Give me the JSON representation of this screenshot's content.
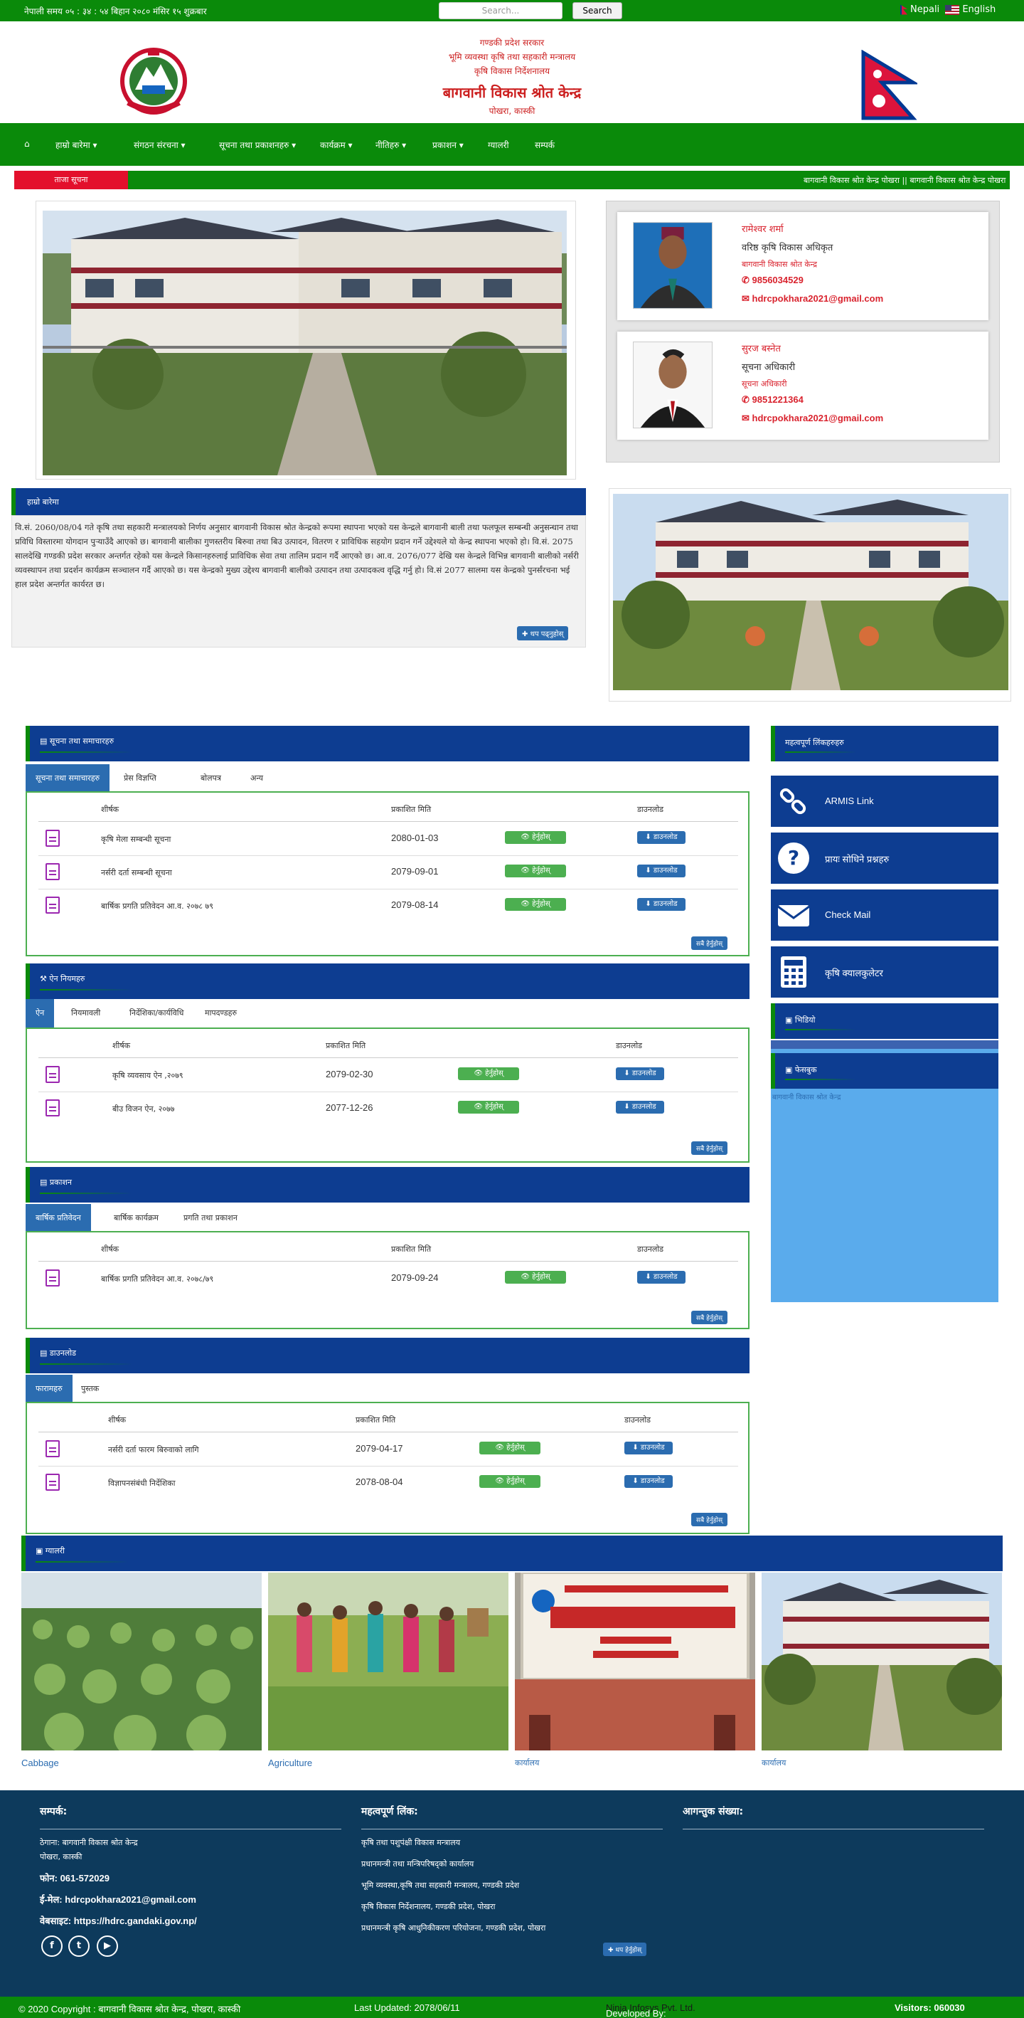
{
  "topbar": {
    "time": "नेपाली समय ०५ : ३४ : ५४ बिहान   २०८० मंसिर १५ शुक्रबार",
    "search_placeholder": "Search...",
    "search_button": "Search",
    "lang_nepali": "Nepali",
    "lang_english": "English"
  },
  "header": {
    "line1": "गण्डकी प्रदेश सरकार",
    "line2": "भूमि व्यवस्था कृषि तथा सहकारी मन्त्रालय",
    "line3": "कृषि विकास निर्देशनालय",
    "title": "बागवानी विकास श्रोत केन्द्र",
    "location": "पोखरा, कास्की"
  },
  "nav": {
    "home_icon": "home-icon",
    "items": [
      "हाम्रो बारेमा",
      "संगठन संरचना",
      "सूचना तथा प्रकाशनहरु",
      "कार्यक्रम",
      "नीतिहरु",
      "प्रकाशन",
      "ग्यालरी",
      "सम्पर्क"
    ]
  },
  "ticker": {
    "label": "ताजा सूचना",
    "text": "बागवानी विकास श्रोत केन्द्र पोखरा  || बागवानी विकास श्रोत केन्द्र पोखरा"
  },
  "officials": [
    {
      "name": "रामेश्वर शर्मा",
      "position": "वरिष्ठ कृषि विकास अधिकृत",
      "org": "बागवानी विकास श्रोत केन्द्र",
      "phone": "9856034529",
      "email": "hdrcpokhara2021@gmail.com"
    },
    {
      "name": "सुरज बस्नेत",
      "position": "सूचना अधिकारी",
      "org": "सूचना अधिकारी",
      "phone": "9851221364",
      "email": "hdrcpokhara2021@gmail.com"
    }
  ],
  "intro": {
    "heading": "हाम्रो बारेमा",
    "text": "वि.सं. 2060/08/04 गते कृषि तथा सहकारी मन्त्रालयको निर्णय अनुसार बागवानी विकास श्रोत केन्द्रको रूपमा स्थापना भएको यस केन्द्रले बागवानी बाली तथा फलफूल सम्बन्धी अनुसन्धान तथा प्रविधि विस्तारमा योगदान पुर्‍याउँदै आएको छ। बागवानी बालीका गुणस्तरीय बिरुवा तथा बिउ उत्पादन, वितरण र प्राविधिक सहयोग प्रदान गर्ने उद्देश्यले यो केन्द्र स्थापना भएको हो। वि.सं. 2075 सालदेखि गण्डकी प्रदेश सरकार अन्तर्गत रहेको यस केन्द्रले किसानहरुलाई प्राविधिक सेवा तथा तालिम प्रदान गर्दै आएको छ। आ.व. 2076/077 देखि यस केन्द्रले विभिन्न बागवानी बालीको नर्सरी व्यवस्थापन तथा प्रदर्शन कार्यक्रम सञ्चालन गर्दै आएको छ। यस केन्द्रको मुख्य उद्देश्य बागवानी बालीको उत्पादन तथा उत्पादकत्व वृद्धि गर्नु हो। वि.सं 2077 सालमा यस केन्द्रको पुनर्संरचना भई हाल प्रदेश अन्तर्गत कार्यरत छ।",
    "more": "थप पढ्नुहोस्"
  },
  "news": {
    "heading": "सूचना तथा समाचारहरु",
    "tabs": [
      "सूचना तथा समाचारहरु",
      "प्रेस विज्ञप्ति",
      "बोलपत्र",
      "अन्य"
    ],
    "headers": [
      "शीर्षक",
      "प्रकाशित मिति",
      "डाउनलोड"
    ],
    "rows": [
      {
        "title": "कृषि मेला सम्बन्धी सूचना",
        "date": "2080-01-03"
      },
      {
        "title": "नर्सरी दर्ता सम्बन्धी सूचना",
        "date": "2079-09-01"
      },
      {
        "title": "बार्षिक प्रगति प्रतिवेदन आ.व. २०७८ ७९",
        "date": "2079-08-14"
      }
    ],
    "view": "हेर्नुहोस्",
    "download": "डाउनलोड",
    "all": "सबै हेर्नुहोस्"
  },
  "laws": {
    "heading": "ऐन नियमहरु",
    "tabs": [
      "ऐन",
      "नियमावली",
      "निर्देशिका/कार्यविधि",
      "मापदण्डहरु"
    ],
    "headers": [
      "शीर्षक",
      "प्रकाशित मिति",
      "डाउनलोड"
    ],
    "rows": [
      {
        "title": "कृषि व्यवसाय ऐन ,२०७९",
        "date": "2079-02-30"
      },
      {
        "title": "बीउ विजन ऐन, २०७७",
        "date": "2077-12-26"
      }
    ],
    "view": "हेर्नुहोस्",
    "download": "डाउनलोड",
    "all": "सबै हेर्नुहोस्"
  },
  "reports": {
    "heading": "प्रकाशन",
    "tabs": [
      "बार्षिक प्रतिवेदन",
      "बार्षिक कार्यक्रम",
      "प्रगति तथा प्रकाशन"
    ],
    "headers": [
      "शीर्षक",
      "प्रकाशित मिति",
      "डाउनलोड"
    ],
    "rows": [
      {
        "title": "बार्षिक प्रगति प्रतिवेदन आ.व. २०७८/७९",
        "date": "2079-09-24"
      }
    ],
    "view": "हेर्नुहोस्",
    "download": "डाउनलोड",
    "all": "सबै हेर्नुहोस्"
  },
  "downloads": {
    "heading": "डाउनलोड",
    "tabs": [
      "फारामहरु",
      "पुस्तक"
    ],
    "headers": [
      "शीर्षक",
      "प्रकाशित मिति",
      "डाउनलोड"
    ],
    "rows": [
      {
        "title": "नर्सरी दर्ता फारम बिरुवाको लागि",
        "date": "2079-04-17"
      },
      {
        "title": "विज्ञापनसंबंधी निर्देशिका",
        "date": "2078-08-04"
      }
    ],
    "view": "हेर्नुहोस्",
    "download": "डाउनलोड",
    "all": "सबै हेर्नुहोस्"
  },
  "sidebar": {
    "heading": "महत्वपूर्ण लिंकहरुहरु",
    "links": [
      {
        "label": "ARMIS Link",
        "icon": "link-icon"
      },
      {
        "label": "प्रायः सोधिने प्रश्नहरु",
        "icon": "question-icon"
      },
      {
        "label": "Check Mail",
        "icon": "mail-icon"
      },
      {
        "label": "कृषि क्यालकुलेटर",
        "icon": "calculator-icon"
      }
    ],
    "video_heading": "भिडियो",
    "fb_heading": "फेसबुक",
    "fb_link": "बागवानी विकास श्रोत केन्द्र"
  },
  "gallery": {
    "heading": "ग्यालरी",
    "items": [
      "Cabbage",
      "Agriculture",
      "कार्यालय",
      "कार्यालय"
    ]
  },
  "footer": {
    "contact_heading": "सम्पर्क:",
    "address_label": "ठेगाना: बागवानी विकास श्रोत केन्द्र",
    "address_line2": "पोखरा, कास्की",
    "phone_label": "फोन:",
    "phone": "061-572029",
    "email_label": "ई-मेल:",
    "email": "hdrcpokhara2021@gmail.com",
    "web_label": "वेबसाइट:",
    "website": "https://hdrc.gandaki.gov.np/",
    "links_heading": "महत्वपूर्ण लिंक:",
    "links": [
      "कृषि तथा पशुपंक्षी विकास मन्त्रालय",
      "प्रधानमन्त्री तथा मन्त्रिपरिषद्को कार्यालय",
      "भूमि व्यवस्था,कृषि तथा सहकारी मन्त्रालय, गण्डकी प्रदेश",
      "कृषि विकास निर्देशनालय, गण्डकी प्रदेश, पोखरा",
      "प्रधानमन्त्री कृषि आधुनिकीकरण परियोजना, गण्डकी प्रदेश, पोखरा"
    ],
    "links_more": "थप हेर्नुहोस्",
    "visitors_heading": "आगन्तुक संख्या:"
  },
  "bottom": {
    "copyright": "© 2020 Copyright : बागवानी विकास श्रोत केन्द्र, पोखरा, कास्की",
    "updated": "Last Updated: 2078/06/11",
    "developed_label": "Developed By:",
    "developer": "Ninja Infosys Pvt. Ltd.",
    "visitors": "Visitors: 060030"
  },
  "colors": {
    "green": "#0a8a0a",
    "navy": "#0d3d91",
    "red": "#d9232e",
    "footer": "#0d3a5c"
  }
}
